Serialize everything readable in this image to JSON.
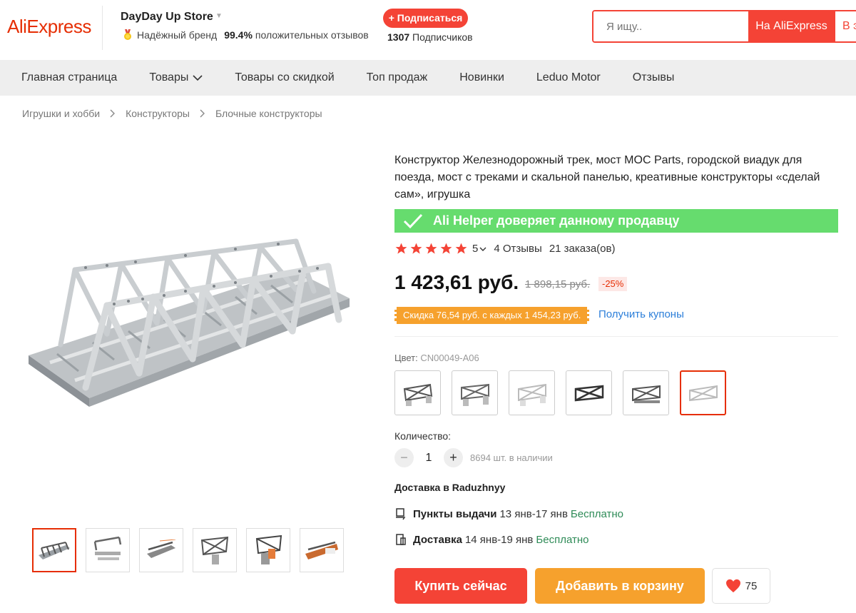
{
  "header": {
    "logo": "AliExpress",
    "store_name": "DayDay Up Store",
    "trusted_brand": "Надёжный бренд",
    "positive_pct": "99.4%",
    "positive_label": "положительных отзывов",
    "subscribe_label": "+ Подписаться",
    "subscribers_count": "1307",
    "subscribers_label": "Подписчиков",
    "search_placeholder": "Я ищу..",
    "search_btn_ali": "На AliExpress",
    "search_btn_store": "В это"
  },
  "nav": {
    "items": [
      "Главная страница",
      "Товары",
      "Товары со скидкой",
      "Топ продаж",
      "Новинки",
      "Leduo Motor",
      "Отзывы"
    ]
  },
  "breadcrumb": [
    "Игрушки и хобби",
    "Конструкторы",
    "Блочные конструкторы"
  ],
  "product": {
    "title": "Конструктор Железнодорожный трек, мост MOC Parts, городской виадук для поезда, мост с треками и скальной панелью, креативные конструкторы «сделай сам», игрушка",
    "helper_text": "Ali Helper доверяет данному продавцу",
    "rating": "5",
    "reviews": "4 Отзывы",
    "orders": "21 заказа(ов)",
    "price": "1 423,61 руб.",
    "old_price": "1 898,15 руб.",
    "discount": "-25%",
    "coupon_text": "Скидка 76,54 руб. с каждых 1 454,23 руб.",
    "get_coupons": "Получить купоны",
    "color_label": "Цвет:",
    "color_value": "CN00049-A06",
    "quantity_label": "Количество:",
    "quantity": "1",
    "stock": "8694 шт. в наличии",
    "delivery_title": "Доставка в Raduzhnyy",
    "pickup_label": "Пункты выдачи",
    "pickup_dates": "13 янв-17 янв",
    "pickup_price": "Бесплатно",
    "delivery_label": "Доставка",
    "delivery_dates": "14 янв-19 янв",
    "delivery_price": "Бесплатно",
    "buy_now": "Купить сейчас",
    "add_to_cart": "Добавить в корзину",
    "wishlist_count": "75"
  },
  "colors": {
    "brand": "#e62e04",
    "accent_red": "#f44336",
    "accent_orange": "#f6a12d",
    "helper_green": "#66dc6e",
    "link_blue": "#2b7ed9"
  },
  "icons": [
    "medal-icon",
    "chevron-down-icon",
    "chevron-right-icon",
    "check-icon",
    "star-icon",
    "pickup-icon",
    "delivery-icon",
    "heart-icon"
  ]
}
